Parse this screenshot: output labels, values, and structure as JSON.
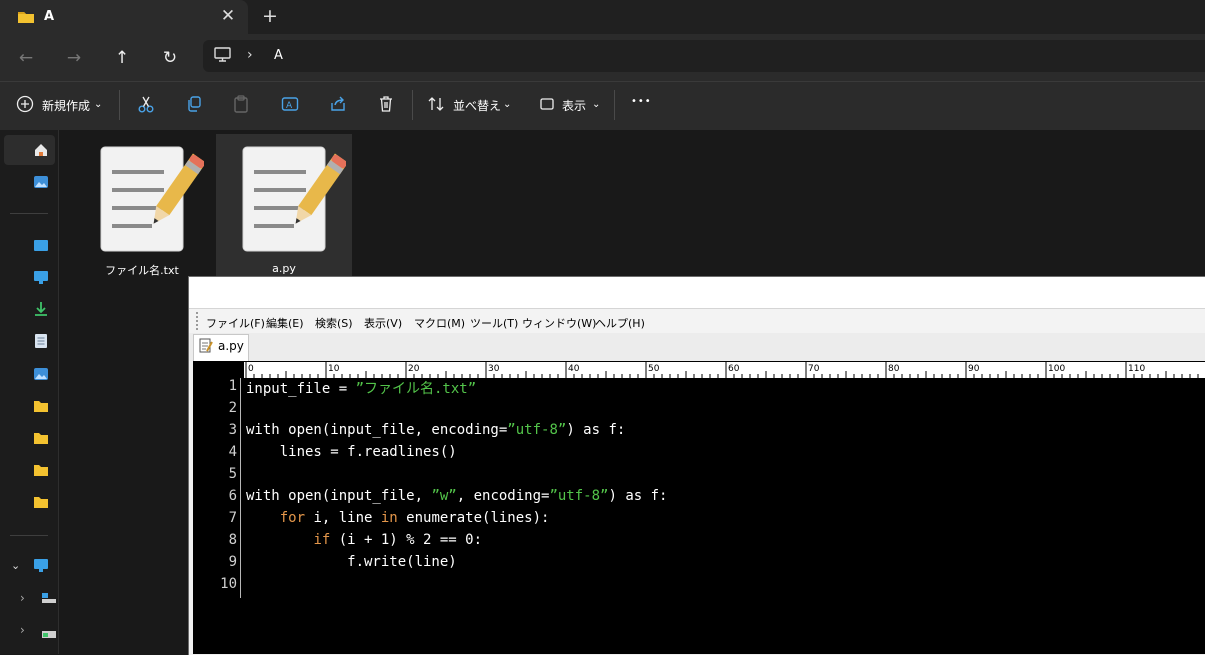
{
  "window": {
    "tab_title": "A",
    "tab_close": "✕",
    "new_tab": "+"
  },
  "nav": {
    "back": "←",
    "forward": "→",
    "up": "↑",
    "refresh": "↻",
    "breadcrumb_sep": "›",
    "breadcrumb": "A"
  },
  "commands": {
    "new_label": "新規作成",
    "sort_label": "並べ替え",
    "view_label": "表示",
    "more": "•••"
  },
  "files": [
    {
      "name": "ファイル名.txt"
    },
    {
      "name": "a.py"
    }
  ],
  "editor": {
    "menus": [
      "ファイル(F)",
      "編集(E)",
      "検索(S)",
      "表示(V)",
      "マクロ(M)",
      "ツール(T)",
      "ウィンドウ(W)",
      "ヘルプ(H)"
    ],
    "tab_label": "a.py",
    "ruler_labels": [
      "0",
      "10",
      "20",
      "30",
      "40",
      "50",
      "60",
      "70",
      "80",
      "90",
      "100",
      "110"
    ],
    "line_numbers": [
      "1",
      "2",
      "3",
      "4",
      "5",
      "6",
      "7",
      "8",
      "9",
      "10"
    ],
    "lines": [
      [
        {
          "t": "input_file = "
        },
        {
          "t": "”ファイル名.txt”",
          "c": "str"
        }
      ],
      [],
      [
        {
          "t": "with open(input_file, encoding="
        },
        {
          "t": "”utf-8”",
          "c": "str"
        },
        {
          "t": ") as f:"
        }
      ],
      [
        {
          "t": "    lines = f.readlines()"
        }
      ],
      [],
      [
        {
          "t": "with open(input_file, "
        },
        {
          "t": "”w”",
          "c": "str"
        },
        {
          "t": ", encoding="
        },
        {
          "t": "”utf-8”",
          "c": "str"
        },
        {
          "t": ") as f:"
        }
      ],
      [
        {
          "t": "    "
        },
        {
          "t": "for",
          "c": "kw"
        },
        {
          "t": " i, line "
        },
        {
          "t": "in",
          "c": "kw"
        },
        {
          "t": " enumerate(lines):"
        }
      ],
      [
        {
          "t": "        "
        },
        {
          "t": "if",
          "c": "kw"
        },
        {
          "t": " (i + 1) % 2 == 0:"
        }
      ],
      [
        {
          "t": "            f.write(line)"
        }
      ],
      []
    ]
  },
  "colors": {
    "string": "#53c44a",
    "keyword": "#e3964a",
    "folder": "#f3c230",
    "accent": "#4aa3e8"
  }
}
